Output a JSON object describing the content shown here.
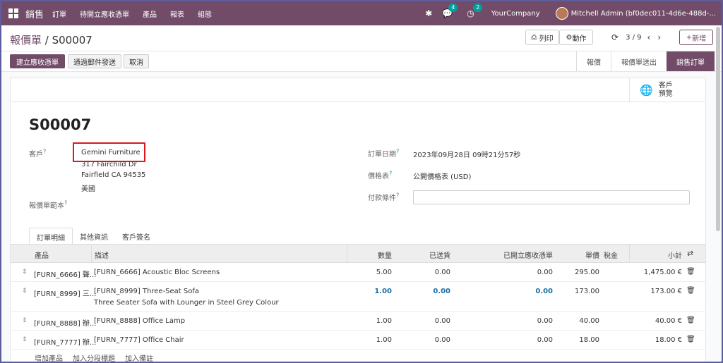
{
  "navbar": {
    "app_name": "銷售",
    "menu": [
      "訂單",
      "待開立應收憑單",
      "產品",
      "報表",
      "組態"
    ],
    "messages_count": "4",
    "activities_count": "2",
    "company": "YourCompany",
    "user": "Mitchell Admin (bf0dec011-4d6e-488d-..."
  },
  "control_panel": {
    "breadcrumb_parent": "報價單",
    "breadcrumb_sep": " / ",
    "breadcrumb_current": "S00007",
    "print_label": "列印",
    "action_label": "動作",
    "pager": "3 / 9",
    "new_label": "新增"
  },
  "statusbar": {
    "actions": [
      "建立應收憑單",
      "通過郵件發送",
      "取消"
    ],
    "stages": [
      "報價",
      "報價單送出",
      "銷售訂單"
    ],
    "active_stage": "銷售訂單"
  },
  "smart_button": {
    "line1": "客戶",
    "line2": "預覽"
  },
  "form": {
    "title": "S00007",
    "customer_label": "客戶",
    "customer_name": "Gemini Furniture",
    "customer_address1": "317 Fairchild Dr",
    "customer_address2": "Fairfield CA 94535",
    "customer_country": "美國",
    "template_label": "報價單範本",
    "order_date_label": "訂單日期",
    "order_date": "2023年09月28日 09時21分57秒",
    "pricelist_label": "價格表",
    "pricelist": "公開價格表 (USD)",
    "payment_terms_label": "付款條件",
    "payment_terms": ""
  },
  "tabs": [
    "訂單明細",
    "其他資訊",
    "客戶簽名"
  ],
  "table": {
    "headers": {
      "product": "產品",
      "description": "描述",
      "quantity": "數量",
      "delivered": "已送貨",
      "invoiced": "已開立應收憑單",
      "unit_price": "單價",
      "taxes": "稅金",
      "subtotal": "小計"
    },
    "rows": [
      {
        "product": "[FURN_6666] 聲...",
        "description": "[FURN_6666] Acoustic Bloc Screens",
        "description2": "",
        "quantity": "5.00",
        "delivered": "0.00",
        "invoiced": "0.00",
        "unit_price": "295.00",
        "subtotal": "1,475.00 €"
      },
      {
        "product": "[FURN_8999] 三...",
        "description": "[FURN_8999] Three-Seat Sofa",
        "description2": "Three Seater Sofa with Lounger in Steel Grey Colour",
        "quantity": "1.00",
        "delivered": "0.00",
        "invoiced": "0.00",
        "unit_price": "173.00",
        "subtotal": "173.00 €"
      },
      {
        "product": "[FURN_8888] 辦...",
        "description": "[FURN_8888] Office Lamp",
        "description2": "",
        "quantity": "1.00",
        "delivered": "0.00",
        "invoiced": "0.00",
        "unit_price": "40.00",
        "subtotal": "40.00 €"
      },
      {
        "product": "[FURN_7777] 辦...",
        "description": "[FURN_7777] Office Chair",
        "description2": "",
        "quantity": "1.00",
        "delivered": "0.00",
        "invoiced": "0.00",
        "unit_price": "18.00",
        "subtotal": "18.00 €"
      }
    ],
    "add_links": [
      "增加產品",
      "加入分段標題",
      "加入備註"
    ]
  },
  "colors": {
    "brand": "#714b67",
    "highlight": "#e0161e",
    "link_blue": "#1a6fa7"
  }
}
